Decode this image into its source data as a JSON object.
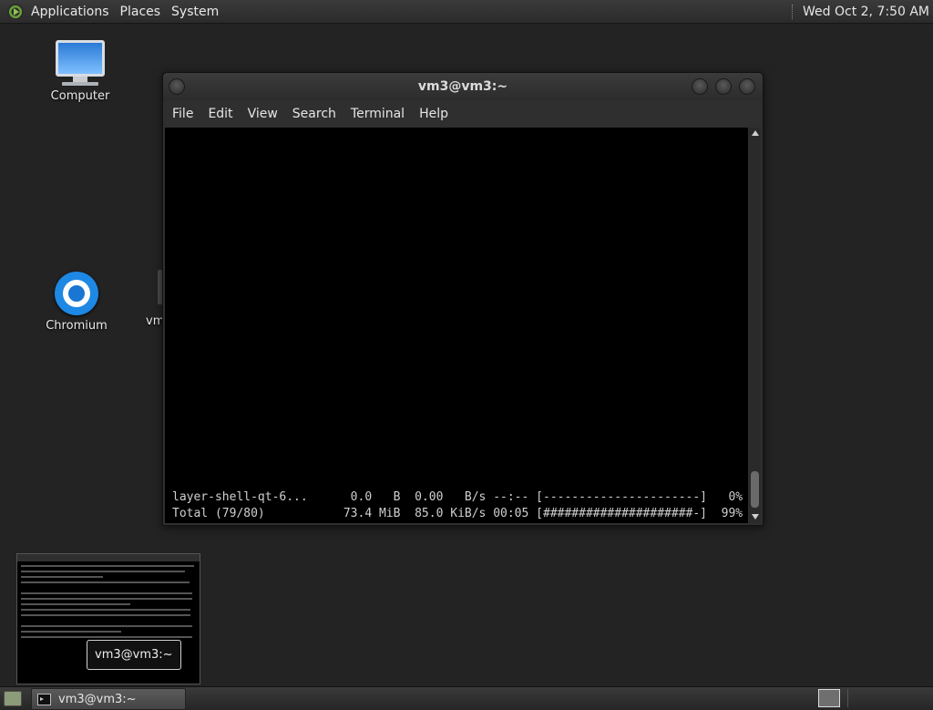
{
  "top_panel": {
    "menus": [
      "Applications",
      "Places",
      "System"
    ],
    "clock": "Wed Oct  2,  7:50 AM"
  },
  "desktop": {
    "icons": [
      {
        "label": "Computer",
        "icon": "computer-icon"
      },
      {
        "label": "Chromium",
        "icon": "chromium-icon"
      },
      {
        "label": "vm",
        "icon": "folder-icon"
      }
    ]
  },
  "terminal": {
    "title": "vm3@vm3:~",
    "menu": [
      "File",
      "Edit",
      "View",
      "Search",
      "Terminal",
      "Help"
    ],
    "lines": [
      "layer-shell-qt-6...      0.0   B  0.00   B/s --:-- [----------------------]   0%",
      "Total (79/80)           73.4 MiB  85.0 KiB/s 00:05 [#####################-]  99%"
    ]
  },
  "preview": {
    "label": "vm3@vm3:~"
  },
  "taskbar": {
    "item_label": "vm3@vm3:~"
  }
}
